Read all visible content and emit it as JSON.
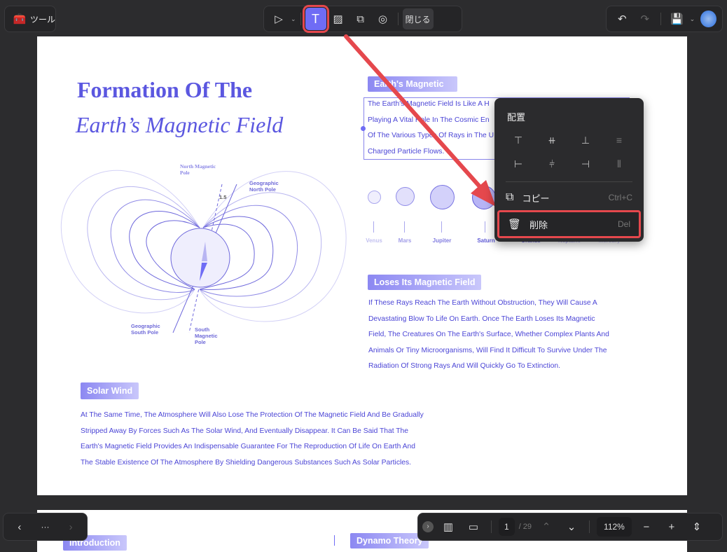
{
  "toolbar": {
    "tools_label": "ツール",
    "close_label": "閉じる"
  },
  "page": {
    "title_line1": "Formation Of The",
    "title_line2": "Earth’s Magnetic Field",
    "diagram": {
      "north_magnetic_pole": "North Magnetic Pole",
      "geographic_north_pole": "Geographic North Pole",
      "angle": "1.5",
      "geographic_south_pole": "Geographic South Pole",
      "south_magnetic_pole": "South Magnetic Pole"
    },
    "earths_magnetic_tag": "Earth's Magnetic",
    "earths_magnetic_lines": [
      "The Earth's Magnetic Field Is Like A H",
      "Playing A Vital Role In The Cosmic En",
      "Of The Various Types Of Rays in The U",
      "Charged Particle Flows."
    ],
    "planets": [
      "Venus",
      "Mars",
      "Jupiter",
      "Saturn",
      "Uranus",
      "Neptune",
      "Mercury"
    ],
    "loses_tag": "Loses Its Magnetic Field",
    "loses_lines": [
      "If These Rays Reach The Earth Without Obstruction, They Will Cause A",
      "Devastating Blow To Life On Earth. Once The Earth Loses Its Magnetic",
      "Field, The Creatures On The Earth's Surface, Whether Complex Plants And",
      "Animals Or Tiny Microorganisms, Will Find It Difficult To Survive Under The",
      "Radiation Of Strong Rays And Will Quickly Go To Extinction."
    ],
    "solar_tag": "Solar Wind",
    "solar_lines": [
      "At The Same Time, The Atmosphere Will Also Lose The Protection Of The Magnetic Field And Be Gradually",
      "Stripped Away By Forces Such As The Solar Wind, And Eventually Disappear. It Can Be Said That The",
      "Earth's Magnetic Field Provides An Indispensable Guarantee For The Reproduction Of Life On Earth And",
      "The Stable Existence Of The Atmosphere By Shielding Dangerous Substances Such As Solar Particles."
    ]
  },
  "page2": {
    "intro_tag": "Introduction",
    "dynamo_tag": "Dynamo Theory"
  },
  "context_menu": {
    "title": "配置",
    "copy": "コピー",
    "copy_shortcut": "Ctrl+C",
    "delete": "削除",
    "delete_shortcut": "Del"
  },
  "bottom": {
    "more": "···",
    "page_current": "1",
    "page_total": "/ 29",
    "zoom": "112%"
  },
  "colors": {
    "accent": "#6f6cf5",
    "highlight": "#e5484d"
  }
}
